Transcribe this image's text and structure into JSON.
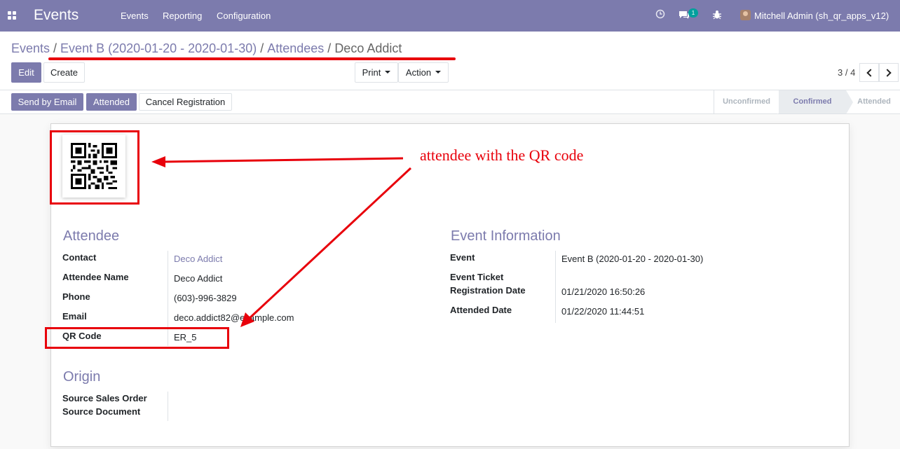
{
  "navbar": {
    "brand": "Events",
    "menu": [
      "Events",
      "Reporting",
      "Configuration"
    ],
    "messages_count": "1",
    "user_name": "Mitchell Admin (sh_qr_apps_v12)"
  },
  "breadcrumb": {
    "items": [
      "Events",
      "Event B (2020-01-20 - 2020-01-30)",
      "Attendees"
    ],
    "current": "Deco Addict",
    "separator": "/"
  },
  "buttons": {
    "edit": "Edit",
    "create": "Create",
    "print": "Print",
    "action": "Action"
  },
  "pager": {
    "value": "3 / 4"
  },
  "status_buttons": {
    "send_by_email": "Send by Email",
    "attended": "Attended",
    "cancel_registration": "Cancel Registration"
  },
  "stages": {
    "items": [
      "Unconfirmed",
      "Confirmed",
      "Attended"
    ],
    "active": "Confirmed"
  },
  "attendee": {
    "title": "Attendee",
    "fields": [
      {
        "label": "Contact",
        "value": "Deco Addict"
      },
      {
        "label": "Attendee Name",
        "value": "Deco Addict"
      },
      {
        "label": "Phone",
        "value": "(603)-996-3829"
      },
      {
        "label": "Email",
        "value": "deco.addict82@example.com"
      },
      {
        "label": "QR Code",
        "value": "ER_5"
      }
    ]
  },
  "event_info": {
    "title": "Event Information",
    "fields": [
      {
        "label": "Event",
        "value": "Event B (2020-01-20 - 2020-01-30)"
      },
      {
        "label": "Event Ticket",
        "value": ""
      },
      {
        "label": "Registration Date",
        "value": "01/21/2020 16:50:26"
      },
      {
        "label": "Attended Date",
        "value": "01/22/2020 11:44:51"
      }
    ]
  },
  "origin": {
    "title": "Origin",
    "fields": [
      {
        "label": "Source Sales Order",
        "value": ""
      },
      {
        "label": "Source Document",
        "value": ""
      }
    ]
  },
  "annotation": {
    "text": "attendee with the QR code"
  },
  "colors": {
    "brand": "#7c7bad",
    "annotation": "#e8000b",
    "badge": "#00a09d"
  }
}
